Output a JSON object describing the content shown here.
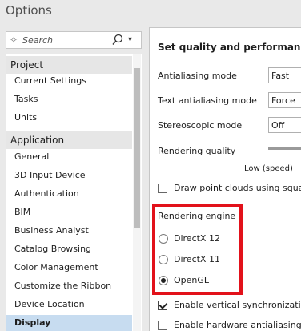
{
  "window": {
    "title": "Options"
  },
  "search": {
    "placeholder": "Search",
    "icon": "search-icon"
  },
  "nav": {
    "project_header": "Project",
    "project_items": [
      "Current Settings",
      "Tasks",
      "Units"
    ],
    "application_header": "Application",
    "application_items": [
      "General",
      "3D Input Device",
      "Authentication",
      "BIM",
      "Business Analyst",
      "Catalog Browsing",
      "Color Management",
      "Customize the Ribbon",
      "Device Location"
    ],
    "selected_item": "Display"
  },
  "panel": {
    "heading": "Set quality and performance",
    "antialiasing": {
      "label": "Antialiasing mode",
      "value": "Fast"
    },
    "text_antialiasing": {
      "label": "Text antialiasing mode",
      "value": "Force"
    },
    "stereoscopic": {
      "label": "Stereoscopic mode",
      "value": "Off"
    },
    "rendering_quality": {
      "label": "Rendering quality",
      "low_label": "Low (speed)"
    },
    "point_clouds": {
      "label": "Draw point clouds using squar",
      "checked": false
    },
    "rendering_engine": {
      "title": "Rendering engine",
      "options": [
        "DirectX 12",
        "DirectX 11",
        "OpenGL"
      ],
      "selected": "OpenGL"
    },
    "vsync": {
      "label": "Enable vertical synchronization",
      "checked": true
    },
    "hw_antialiasing": {
      "label": "Enable hardware antialiasing",
      "checked": false
    }
  },
  "colors": {
    "highlight": "#e2111a",
    "selected_bg": "#c7dcf0",
    "section_bg": "#e6e6e6"
  }
}
